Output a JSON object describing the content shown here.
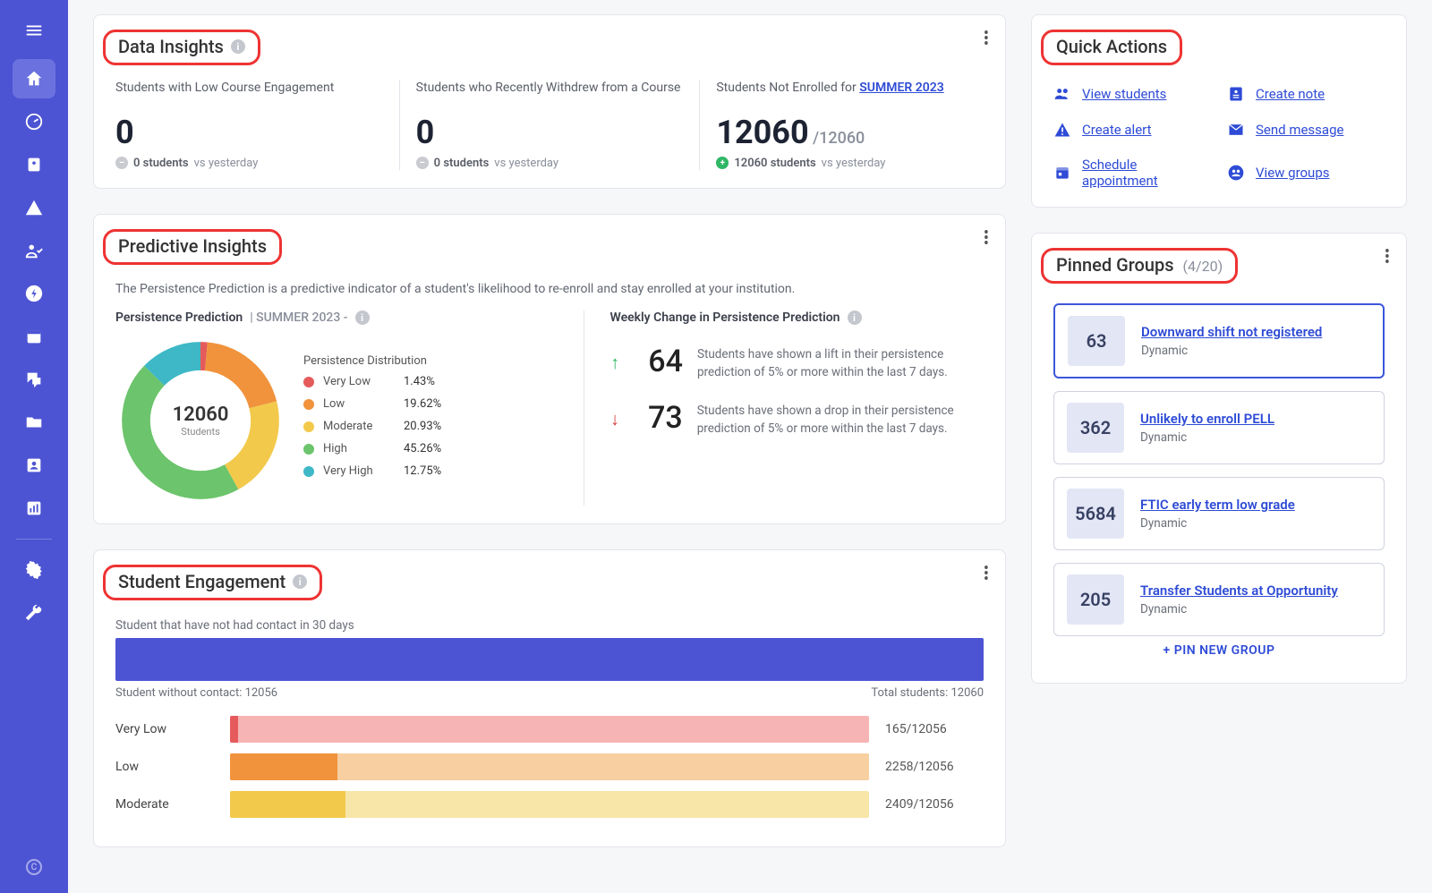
{
  "colors": {
    "very_low": "#e55b5b",
    "low": "#f0933c",
    "moderate": "#f3c94b",
    "high": "#6cc46c",
    "very_high": "#3eb8c6",
    "very_low_bg": "#f6b4b4",
    "low_bg": "#f7cfa1",
    "moderate_bg": "#f7e6a8"
  },
  "sidebar": [
    {
      "name": "menu-icon"
    },
    {
      "name": "home-icon"
    },
    {
      "name": "dashboard-icon"
    },
    {
      "name": "students-icon"
    },
    {
      "name": "alerts-icon"
    },
    {
      "name": "user-check-icon"
    },
    {
      "name": "bolt-icon"
    },
    {
      "name": "calendar-icon"
    },
    {
      "name": "chat-icon"
    },
    {
      "name": "folder-icon"
    },
    {
      "name": "contact-icon"
    },
    {
      "name": "chart-icon"
    },
    {
      "name": "settings-icon"
    },
    {
      "name": "wrench-icon"
    }
  ],
  "data_insights": {
    "title": "Data Insights",
    "items": [
      {
        "label": "Students with Low Course Engagement",
        "value": "0",
        "delta_kind": "neutral",
        "delta": "0 students",
        "delta_suffix": "vs yesterday"
      },
      {
        "label": "Students who Recently Withdrew from a Course",
        "value": "0",
        "delta_kind": "neutral",
        "delta": "0 students",
        "delta_suffix": "vs yesterday"
      },
      {
        "label_prefix": "Students Not Enrolled for ",
        "label_link": "SUMMER 2023",
        "value": "12060",
        "value_sub": "/12060",
        "delta_kind": "up",
        "delta": "12060 students",
        "delta_suffix": "vs yesterday"
      }
    ]
  },
  "predictive": {
    "title": "Predictive Insights",
    "desc": "The Persistence Prediction is a predictive indicator of a student's likelihood to re-enroll and stay enrolled at your institution.",
    "subhead_main": "Persistence Prediction",
    "subhead_term": "| SUMMER 2023 -",
    "donut_total": "12060",
    "donut_label": "Students",
    "legend_title": "Persistence Distribution",
    "distribution": [
      {
        "name": "Very Low",
        "pct": "1.43%",
        "value": 1.43,
        "color": "very_low"
      },
      {
        "name": "Low",
        "pct": "19.62%",
        "value": 19.62,
        "color": "low"
      },
      {
        "name": "Moderate",
        "pct": "20.93%",
        "value": 20.93,
        "color": "moderate"
      },
      {
        "name": "High",
        "pct": "45.26%",
        "value": 45.26,
        "color": "high"
      },
      {
        "name": "Very High",
        "pct": "12.75%",
        "value": 12.75,
        "color": "very_high"
      }
    ],
    "weekly_title": "Weekly Change in Persistence Prediction",
    "weekly_up": {
      "num": "64",
      "text": "Students have shown a lift in their persistence prediction of 5% or more within the last 7 days."
    },
    "weekly_down": {
      "num": "73",
      "text": "Students have shown a drop in their persistence prediction of 5% or more within the last 7 days."
    }
  },
  "engagement": {
    "title": "Student Engagement",
    "sub": "Student that have not had contact in 30 days",
    "caption_left": "Student without contact: 12056",
    "caption_right": "Total students: 12060",
    "total": 12056,
    "rows": [
      {
        "name": "Very Low",
        "count": "165/12056",
        "value": 165,
        "color": "very_low",
        "bg": "very_low_bg"
      },
      {
        "name": "Low",
        "count": "2258/12056",
        "value": 2258,
        "color": "low",
        "bg": "low_bg"
      },
      {
        "name": "Moderate",
        "count": "2409/12056",
        "value": 2409,
        "color": "moderate",
        "bg": "moderate_bg"
      }
    ]
  },
  "quick_actions": {
    "title": "Quick Actions",
    "items": [
      {
        "label": "View students",
        "icon": "people-icon"
      },
      {
        "label": "Create note",
        "icon": "note-icon"
      },
      {
        "label": "Create alert",
        "icon": "warning-icon"
      },
      {
        "label": "Send message",
        "icon": "mail-icon"
      },
      {
        "label": "Schedule appointment",
        "icon": "cal-icon"
      },
      {
        "label": "View groups",
        "icon": "groups-icon"
      }
    ]
  },
  "pinned": {
    "title": "Pinned Groups",
    "count": "(4/20)",
    "add": "+ PIN NEW GROUP",
    "items": [
      {
        "n": "63",
        "title": "Downward shift not registered",
        "sub": "Dynamic",
        "featured": true
      },
      {
        "n": "362",
        "title": "Unlikely to enroll PELL",
        "sub": "Dynamic"
      },
      {
        "n": "5684",
        "title": "FTIC early term low grade",
        "sub": "Dynamic"
      },
      {
        "n": "205",
        "title": "Transfer Students at Opportunity",
        "sub": "Dynamic"
      }
    ]
  },
  "chart_data": [
    {
      "type": "pie",
      "title": "Persistence Distribution",
      "categories": [
        "Very Low",
        "Low",
        "Moderate",
        "High",
        "Very High"
      ],
      "values": [
        1.43,
        19.62,
        20.93,
        45.26,
        12.75
      ],
      "total_label": "12060 Students"
    },
    {
      "type": "bar",
      "title": "Student Engagement — students without contact in 30 days, by persistence level",
      "categories": [
        "Very Low",
        "Low",
        "Moderate"
      ],
      "values": [
        165,
        2258,
        2409
      ],
      "denominator": 12056
    }
  ]
}
